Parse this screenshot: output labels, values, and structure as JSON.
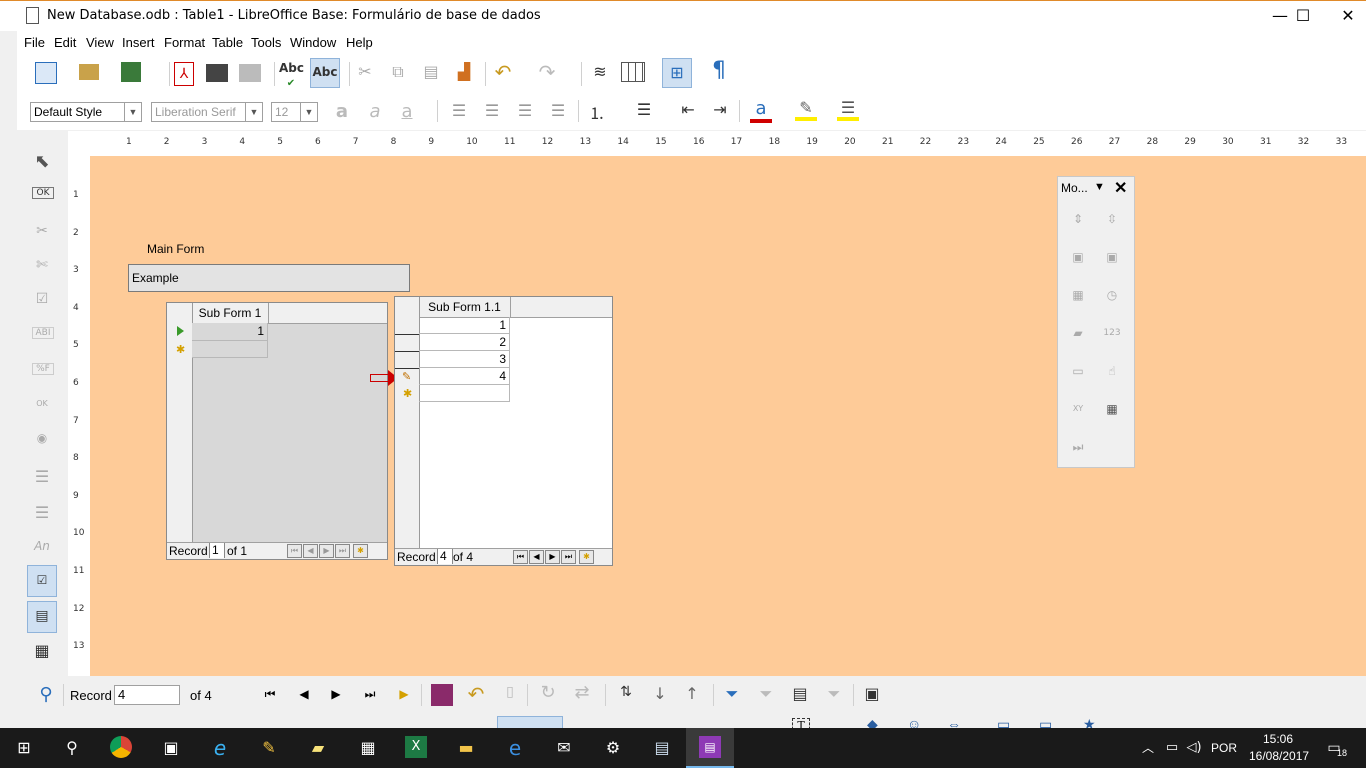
{
  "window": {
    "title": "New Database.odb : Table1 - LibreOffice Base: Formulário de base de dados",
    "minimize": "—",
    "maximize": "☐",
    "close": "✕"
  },
  "menu": [
    "File",
    "Edit",
    "View",
    "Insert",
    "Format",
    "Table",
    "Tools",
    "Window",
    "Help"
  ],
  "formatting": {
    "paragraph_style": "Default Style",
    "font_name": "Liberation Serif",
    "font_size": "12"
  },
  "ruler": {
    "h_ticks": [
      "1",
      "2",
      "3",
      "4",
      "5",
      "6",
      "7",
      "8",
      "9",
      "10",
      "11",
      "12",
      "13",
      "14",
      "15",
      "16",
      "17",
      "18",
      "19",
      "20",
      "21",
      "22",
      "23",
      "24",
      "25",
      "26",
      "27",
      "28",
      "29",
      "30",
      "31",
      "32",
      "33"
    ],
    "v_ticks": [
      "1",
      "2",
      "3",
      "4",
      "5",
      "6",
      "7",
      "8",
      "9",
      "10",
      "11",
      "12",
      "13"
    ]
  },
  "form": {
    "main_label": "Main Form",
    "main_field_value": "Example",
    "subform1": {
      "header": "Sub Form 1",
      "rows": [
        "1"
      ],
      "nav": {
        "record_label": "Record",
        "current": "1",
        "of_text": "of 1"
      }
    },
    "subform11": {
      "header": "Sub Form 1.1",
      "rows": [
        "1",
        "2",
        "3",
        "4"
      ],
      "nav": {
        "record_label": "Record",
        "current": "4",
        "of_text": "of 4"
      }
    }
  },
  "more_controls": {
    "title": "Mo..."
  },
  "form_navigation": {
    "record_label": "Record",
    "record_value": "4",
    "of_text": "of 4"
  },
  "taskbar": {
    "language": "POR",
    "time": "15:06",
    "date": "16/08/2017",
    "notifications": "18"
  },
  "colors": {
    "canvas": "#fecb98",
    "accent": "#2a6ebb",
    "taskbar": "#1a1a1a"
  }
}
